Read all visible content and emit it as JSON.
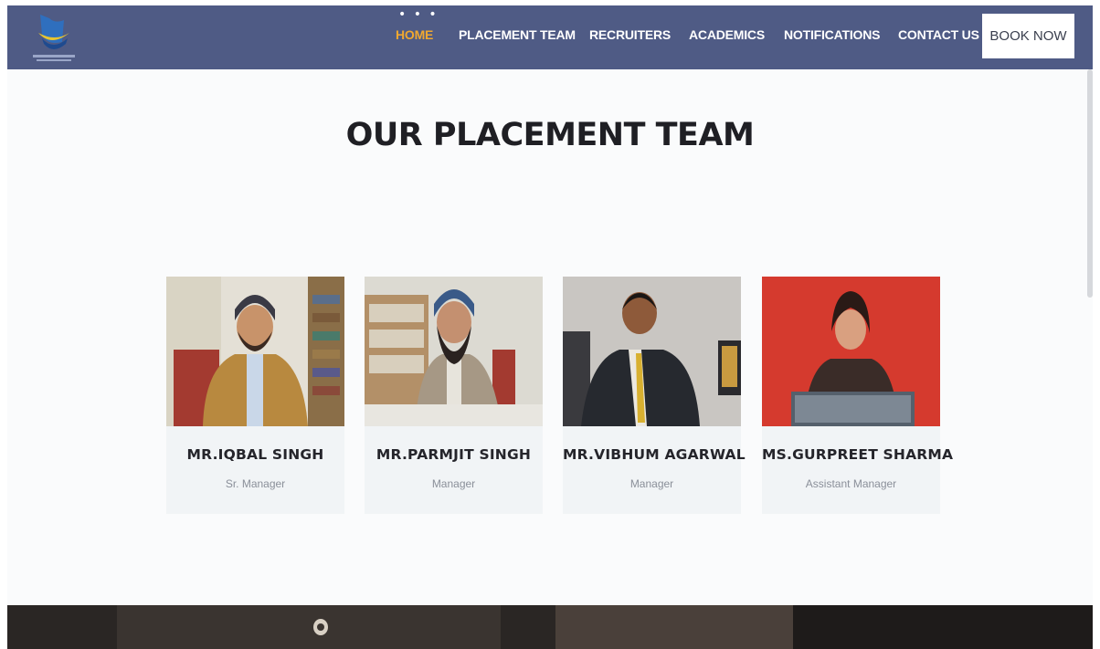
{
  "nav": {
    "items": [
      {
        "label": "HOME",
        "active": true
      },
      {
        "label": "PLACEMENT TEAM",
        "active": false
      },
      {
        "label": "RECRUITERS",
        "active": false
      },
      {
        "label": "ACADEMICS",
        "active": false
      },
      {
        "label": "NOTIFICATIONS",
        "active": false
      },
      {
        "label": "CONTACT US",
        "active": false
      }
    ],
    "book_label": "BOOK NOW",
    "dots": "• • •"
  },
  "section": {
    "title": "OUR PLACEMENT TEAM"
  },
  "team": [
    {
      "name": "MR.IQBAL SINGH",
      "role": "Sr. Manager"
    },
    {
      "name": "MR.PARMJIT SINGH",
      "role": "Manager"
    },
    {
      "name": "MR.VIBHUM AGARWAL",
      "role": "Manager"
    },
    {
      "name": "MS.GURPREET SHARMA",
      "role": "Assistant Manager"
    }
  ],
  "colors": {
    "navbar": "#4f5b85",
    "active": "#f0a830",
    "card": "#f1f4f6"
  }
}
